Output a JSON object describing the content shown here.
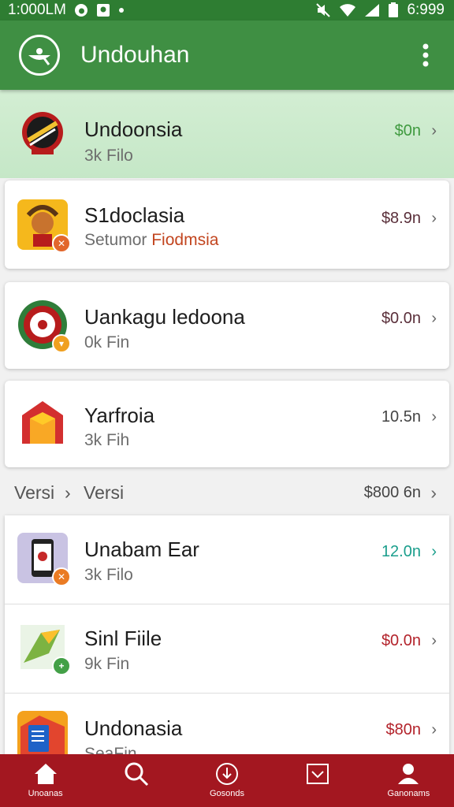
{
  "status_bar": {
    "time": "1:000LM",
    "battery_text": "6:999"
  },
  "app_bar": {
    "title": "Undouhan",
    "logo_icon": "globe-logo-icon",
    "menu_icon": "more-vert-icon"
  },
  "featured": {
    "title": "Undoonsia",
    "subtitle": "3k Filo",
    "price": "$0n",
    "price_color": "#3f9a3f"
  },
  "cards": [
    {
      "title": "S1doclasia",
      "subtitle_a": "Setumor",
      "subtitle_b": "Fiodmsia",
      "price": "$8.9n",
      "price_color": "#5a2f3a"
    },
    {
      "title": "Uankagu ledoona",
      "subtitle": "0k Fin",
      "price": "$0.0n",
      "price_color": "#5a2f3a"
    },
    {
      "title": "Yarfroia",
      "subtitle": "3k Fih",
      "price": "10.5n",
      "price_color": "#444444"
    }
  ],
  "section": {
    "left": "Versi",
    "middle": "Versi",
    "right": "$800 6n"
  },
  "list": [
    {
      "title": "Unabam Ear",
      "subtitle": "3k Filo",
      "price": "12.0n",
      "price_color": "#1a9e8c"
    },
    {
      "title": "Sinl Fiile",
      "subtitle": "9k Fin",
      "price": "$0.0n",
      "price_color": "#b3232b"
    },
    {
      "title": "Undonasia",
      "subtitle": "SeaFin",
      "price": "$80n",
      "price_color": "#b3232b"
    }
  ],
  "bottom_nav": [
    {
      "label": "Unoanas",
      "icon": "home-icon"
    },
    {
      "label": "",
      "icon": "search-icon"
    },
    {
      "label": "Gosonds",
      "icon": "download-icon"
    },
    {
      "label": "",
      "icon": "inbox-icon"
    },
    {
      "label": "Ganonams",
      "icon": "profile-icon"
    }
  ],
  "colors": {
    "app_bar": "#3f8f43",
    "status_bar": "#2e7d32",
    "bottom_nav": "#a31720"
  }
}
